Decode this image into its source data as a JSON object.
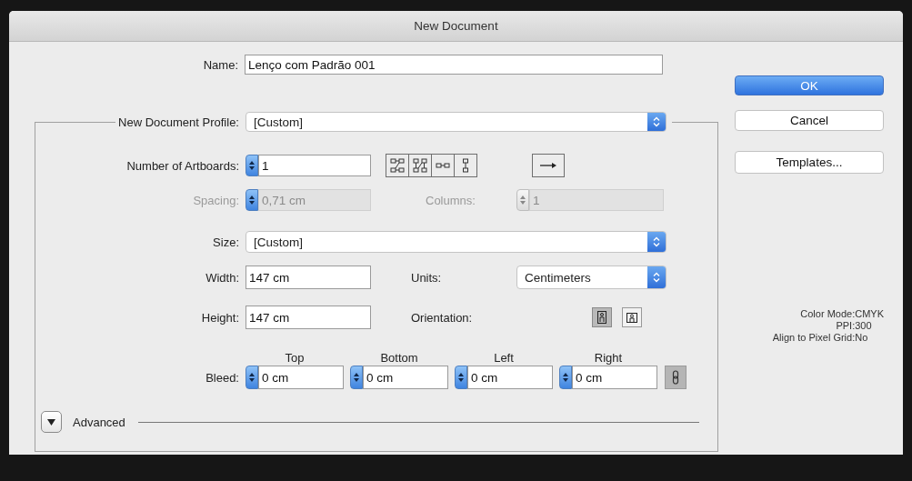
{
  "window": {
    "title": "New Document"
  },
  "name": {
    "label": "Name:",
    "value": "Lenço com Padrão 001"
  },
  "profile": {
    "label": "New Document Profile:",
    "value": "[Custom]"
  },
  "artboards": {
    "label": "Number of Artboards:",
    "value": "1"
  },
  "spacing": {
    "label": "Spacing:",
    "value": "0,71 cm",
    "disabled": true,
    "spinner_enabled": true
  },
  "columns": {
    "label": "Columns:",
    "value": "1",
    "disabled": true,
    "spinner_enabled": false
  },
  "size": {
    "label": "Size:",
    "value": "[Custom]"
  },
  "width": {
    "label": "Width:",
    "value": "147 cm"
  },
  "units": {
    "label": "Units:",
    "value": "Centimeters"
  },
  "height": {
    "label": "Height:",
    "value": "147 cm"
  },
  "orientation": {
    "label": "Orientation:",
    "options": [
      {
        "kind": "portrait",
        "selected": true
      },
      {
        "kind": "landscape",
        "selected": false
      }
    ]
  },
  "bleed": {
    "label": "Bleed:",
    "linked": true,
    "fields": [
      {
        "heading": "Top",
        "value": "0 cm"
      },
      {
        "heading": "Bottom",
        "value": "0 cm"
      },
      {
        "heading": "Left",
        "value": "0 cm"
      },
      {
        "heading": "Right",
        "value": "0 cm"
      }
    ]
  },
  "advanced": {
    "label": "Advanced"
  },
  "buttons": [
    {
      "label": "OK",
      "default": true
    },
    {
      "label": "Cancel",
      "default": false
    },
    {
      "label": "Templates...",
      "default": false
    }
  ],
  "info": [
    {
      "label": "Color Mode:",
      "value": "CMYK"
    },
    {
      "label": "PPI:",
      "value": "300"
    },
    {
      "label": "Align to Pixel Grid:",
      "value": "No"
    }
  ]
}
